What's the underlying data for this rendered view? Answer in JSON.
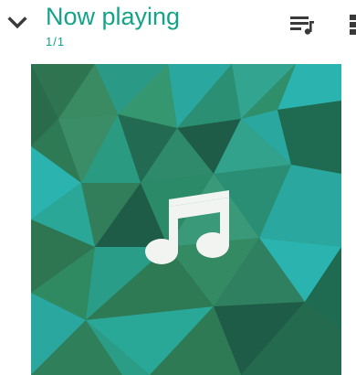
{
  "header": {
    "title": "Now playing",
    "queue_position": "1/1"
  },
  "icons": {
    "collapse": "chevron-down-icon",
    "queue": "queue-music-icon",
    "more": "more-vert-icon",
    "artwork": "music-note-icon"
  },
  "colors": {
    "accent": "#14a389",
    "icon": "#3a3a3a",
    "art_green_dark": "#1e5c48",
    "art_green": "#2f7a58",
    "art_teal": "#2aa79e",
    "art_cyan": "#2bb3b0"
  }
}
